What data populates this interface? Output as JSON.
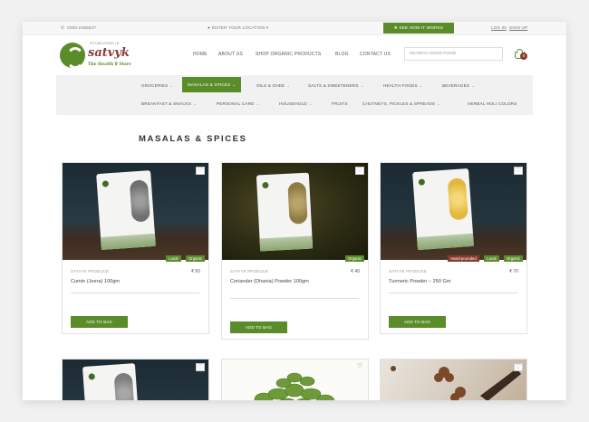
{
  "topbar": {
    "phone": "0250-2455647",
    "location": "ENTER YOUR LOCATION",
    "how_it_works": "SEE HOW IT WORKS",
    "login": "LOG IN",
    "signup": "SIGN UP"
  },
  "logo": {
    "name": "satvyk",
    "established": "ESTABLISHED IN",
    "tagline": "The Health ℣ Store"
  },
  "nav": [
    "HOME",
    "ABOUT US",
    "SHOP ORGANIC PRODUCTS",
    "BLOG",
    "CONTACT US"
  ],
  "search": {
    "placeholder": "SEARCH GOOD FOOD"
  },
  "cart": {
    "count": "0"
  },
  "categories_row1": [
    "GROCERIES",
    "MASALAS & SPICES",
    "OILS & GHEE",
    "SALTS & SWEETENERS",
    "HEALTH FOODS",
    "BEVERAGES"
  ],
  "categories_row2": [
    "BREAKFAST & SNACKS",
    "PERSONAL CARE",
    "HOUSEHOLD",
    "FRUITS",
    "CHUTNEYS, PICKLES & SPREADS",
    "HERBAL HOLI COLORS"
  ],
  "page_title": "MASALAS & SPICES",
  "products": [
    {
      "brand": "SATVYK PRODUCE",
      "price": "₹ 50",
      "name": "Cumin (Jeera) 100gm",
      "badges": [
        "Local",
        "Organic"
      ],
      "button": "ADD TO BAG",
      "color": "#6f6f6f"
    },
    {
      "brand": "SATVYK PRODUCE",
      "price": "₹ 40",
      "name": "Coriander (Dhania) Powder 100gm",
      "badges": [
        "Organic"
      ],
      "button": "ADD TO BAG",
      "color": "#9a8652"
    },
    {
      "brand": "SATVYK PRODUCE",
      "price": "₹ 70",
      "name": "Turmeric Powder – 250 Gm",
      "badges": [
        "Hand-pounded",
        "Local",
        "Organic"
      ],
      "button": "ADD TO BAG",
      "color": "#e9c24a"
    }
  ],
  "icons": {
    "heart": "heart-icon",
    "pin": "location-pin-icon",
    "phone": "phone-icon",
    "cart": "cart-icon",
    "chevron": "chevron-down-icon"
  },
  "colors": {
    "accent": "#5b8c2a",
    "brand": "#8a3a3a"
  }
}
